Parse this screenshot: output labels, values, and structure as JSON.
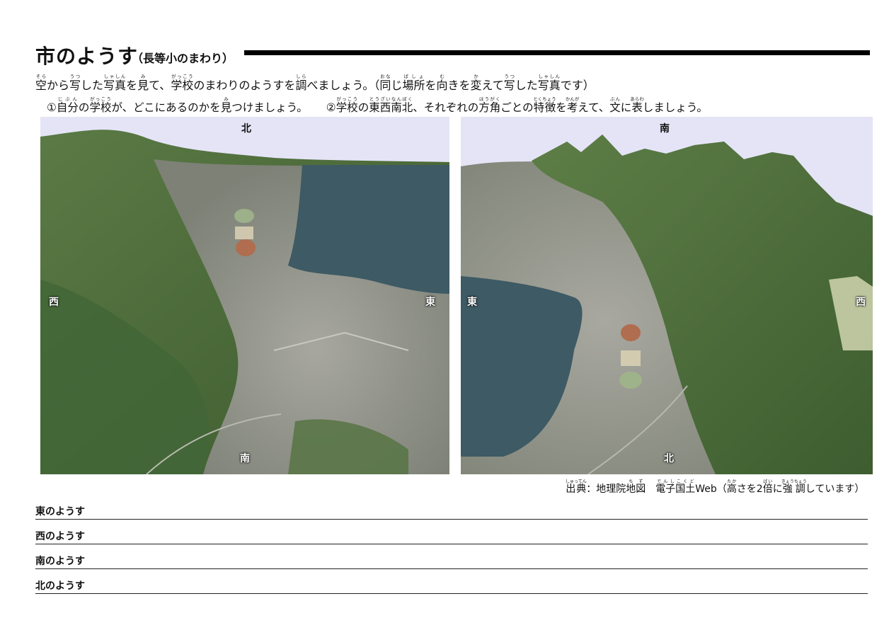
{
  "header": {
    "title": "市のようす",
    "subtitle": "（長等小のまわり）"
  },
  "instructions": {
    "intro": [
      {
        "t": "空",
        "r": "そら"
      },
      {
        "t": "から"
      },
      {
        "t": "写",
        "r": "うつ"
      },
      {
        "t": "した"
      },
      {
        "t": "写真",
        "r": "しゃしん"
      },
      {
        "t": "を"
      },
      {
        "t": "見",
        "r": "み"
      },
      {
        "t": "て、"
      },
      {
        "t": "学校",
        "r": "がっこう"
      },
      {
        "t": "のまわりのようすを"
      },
      {
        "t": "調",
        "r": "しら"
      },
      {
        "t": "べましょう。（"
      },
      {
        "t": "同",
        "r": "おな"
      },
      {
        "t": "じ"
      },
      {
        "t": "場所",
        "r": "ばしょ"
      },
      {
        "t": "を"
      },
      {
        "t": "向",
        "r": "む"
      },
      {
        "t": "きを"
      },
      {
        "t": "変",
        "r": "か"
      },
      {
        "t": "えて"
      },
      {
        "t": "写",
        "r": "うつ"
      },
      {
        "t": "した"
      },
      {
        "t": "写真",
        "r": "しゃしん"
      },
      {
        "t": "です）"
      }
    ],
    "task1": [
      {
        "t": "①"
      },
      {
        "t": "自分",
        "r": "じぶん"
      },
      {
        "t": "の"
      },
      {
        "t": "学校",
        "r": "がっこう"
      },
      {
        "t": "が、どこにあるのかを"
      },
      {
        "t": "見",
        "r": "み"
      },
      {
        "t": "つけましょう。"
      }
    ],
    "task2": [
      {
        "t": "②"
      },
      {
        "t": "学校",
        "r": "がっこう"
      },
      {
        "t": "の"
      },
      {
        "t": "東西南北",
        "r": "とうざいなんぼく"
      },
      {
        "t": "、それぞれの"
      },
      {
        "t": "方角",
        "r": "ほうがく"
      },
      {
        "t": "ごとの"
      },
      {
        "t": "特徴",
        "r": "とくちょう"
      },
      {
        "t": "を"
      },
      {
        "t": "考",
        "r": "かんが"
      },
      {
        "t": "えて、"
      },
      {
        "t": "文",
        "r": "ぶん"
      },
      {
        "t": "に"
      },
      {
        "t": "表",
        "r": "あらわ"
      },
      {
        "t": "しましょう。"
      }
    ]
  },
  "photos": {
    "north_up": {
      "top": "北",
      "bottom": "南",
      "left": "西",
      "right": "東"
    },
    "south_up": {
      "top": "南",
      "bottom": "北",
      "left": "東",
      "right": "西"
    }
  },
  "source": [
    {
      "t": "出典",
      "r": "しゅってん"
    },
    {
      "t": "：地理院"
    },
    {
      "t": "地図",
      "r": "ちず"
    },
    {
      "t": "　"
    },
    {
      "t": "電子国土",
      "r": "でんしこくど"
    },
    {
      "t": "Web（"
    },
    {
      "t": "高",
      "r": "たか"
    },
    {
      "t": "さを2"
    },
    {
      "t": "倍",
      "r": "ばい"
    },
    {
      "t": "に"
    },
    {
      "t": "強調",
      "r": "きょうちょう"
    },
    {
      "t": "しています）"
    }
  ],
  "answer_lines": [
    {
      "label": "東のようす"
    },
    {
      "label": "西のようす"
    },
    {
      "label": "南のようす"
    },
    {
      "label": "北のようす"
    }
  ],
  "colors": {
    "sky": "#e4e4f6",
    "water": "#3e5a64",
    "forest": "#4d6b3c",
    "city": "#9a9a92"
  }
}
